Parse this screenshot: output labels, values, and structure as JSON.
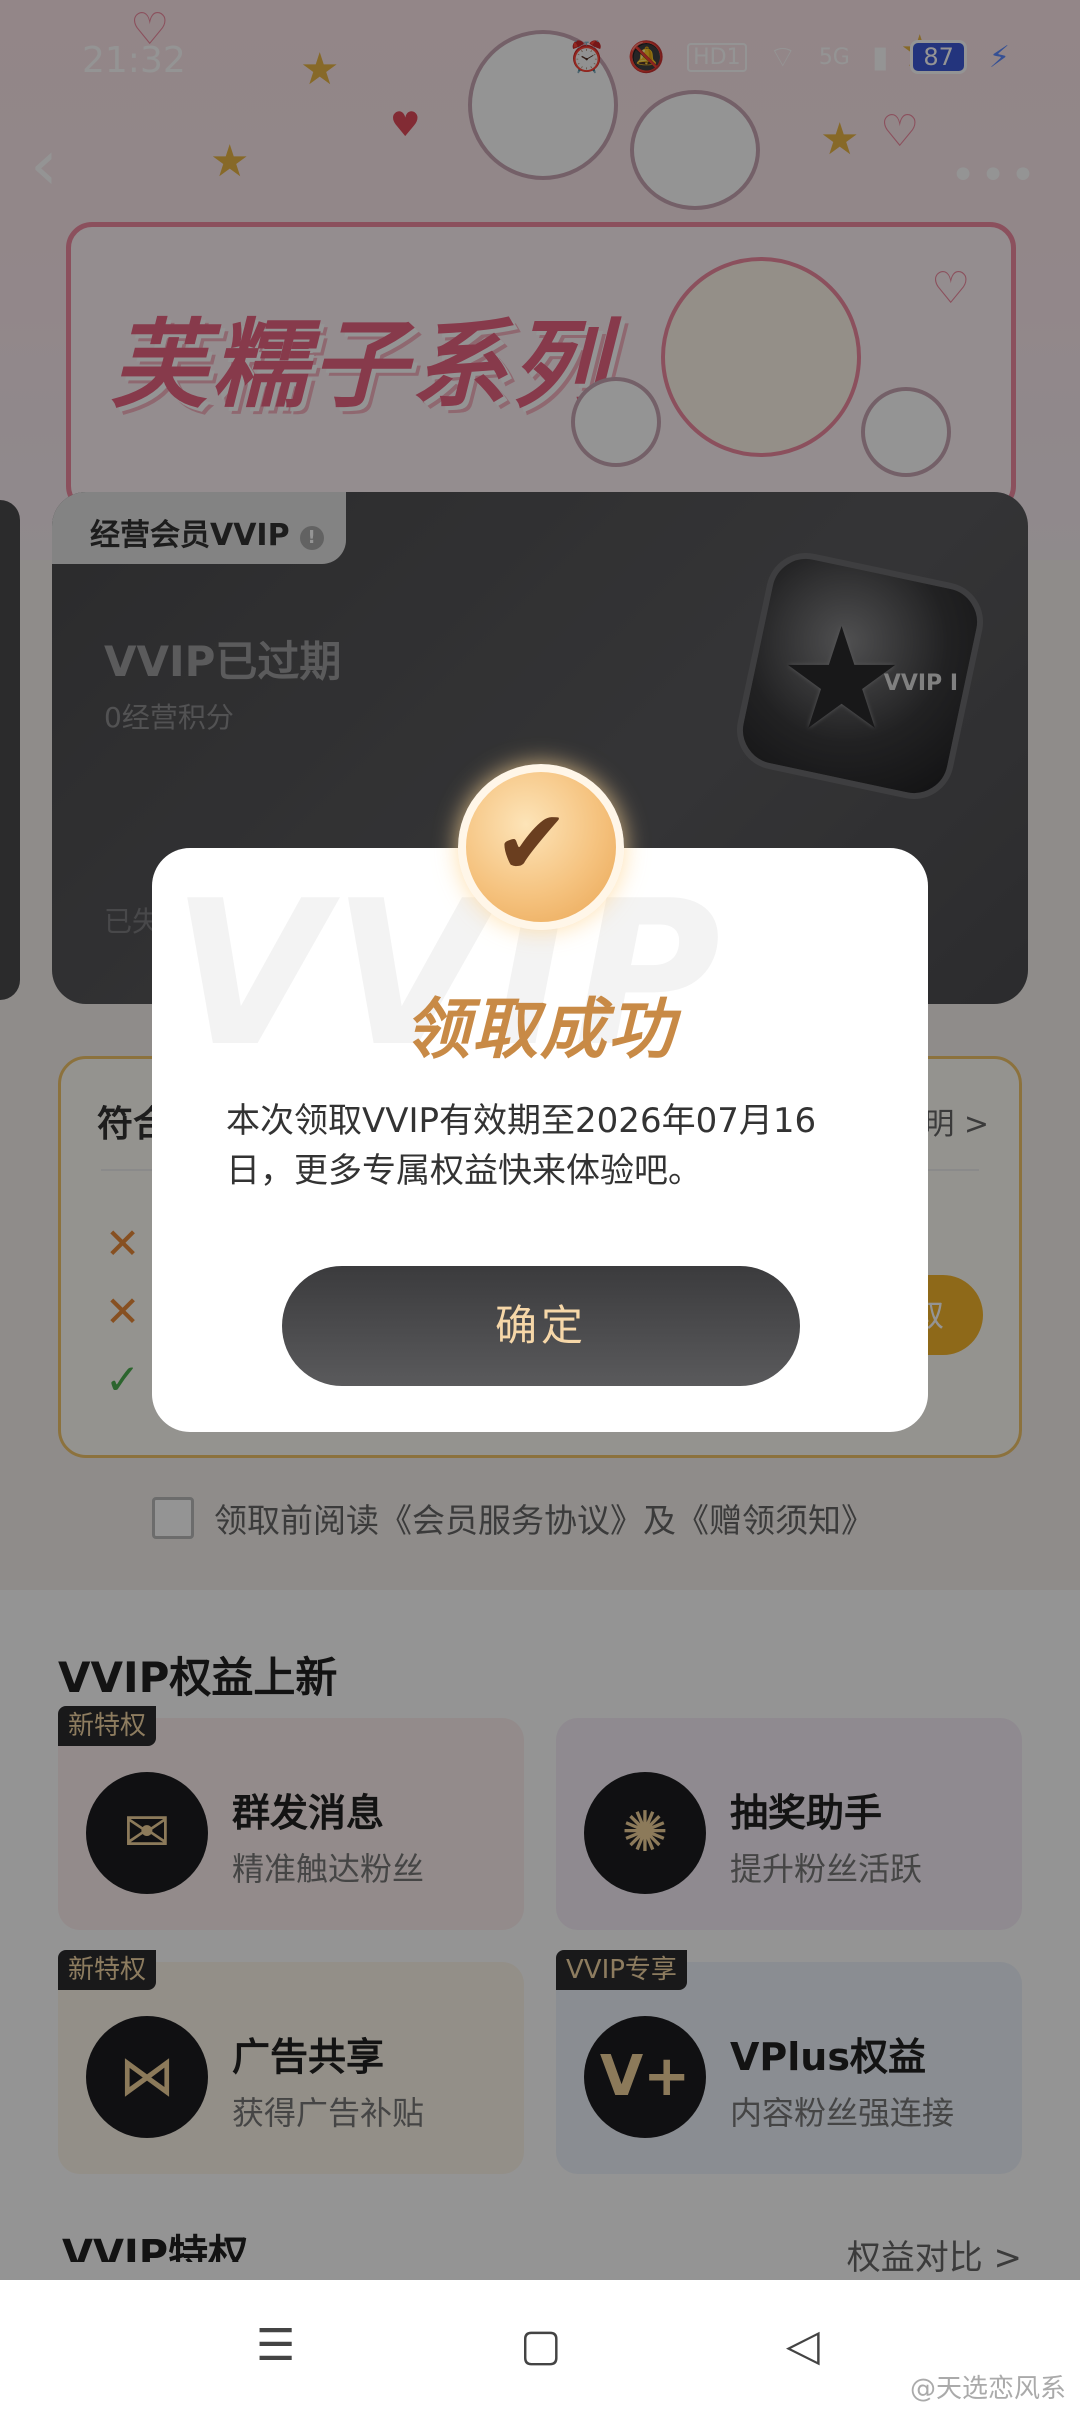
{
  "statusbar": {
    "time": "21:32",
    "network": "5G",
    "hd": "HD1",
    "battery": "87"
  },
  "banner": {
    "title": "芙糯子系列"
  },
  "vip_card": {
    "tab": "经营会员VVIP",
    "status": "VVIP已过期",
    "points": "0经营积分",
    "footer": "已失",
    "medal_label": "VVIP I"
  },
  "conditions": {
    "title": "符合",
    "link": "明 >",
    "claim": "取"
  },
  "agreement": {
    "text": "领取前阅读《会员服务协议》及《赠领须知》"
  },
  "benefits": {
    "title": "VVIP权益上新",
    "items": [
      {
        "tag": "新特权",
        "title": "群发消息",
        "sub": "精准触达粉丝",
        "icon": "message-icon"
      },
      {
        "tag": "",
        "title": "抽奖助手",
        "sub": "提升粉丝活跃",
        "icon": "lottery-wheel-icon"
      },
      {
        "tag": "新特权",
        "title": "广告共享",
        "sub": "获得广告补贴",
        "icon": "share-icon"
      },
      {
        "tag": "VVIP专享",
        "title": "VPlus权益",
        "sub": "内容粉丝强连接",
        "icon": "vplus-icon"
      }
    ],
    "more_left": "VVIP特权",
    "more_right": "权益对比 >"
  },
  "dialog": {
    "title": "领取成功",
    "message": "本次领取VVIP有效期至2026年07月16日，更多专属权益快来体验吧。",
    "confirm": "确定",
    "bg_text": "VVIP"
  },
  "watermark": "@天选恋风系",
  "colors": {
    "overlay": "#00000069",
    "accent_gold": "#c88a46",
    "button_dark": "#3b3b3d"
  }
}
